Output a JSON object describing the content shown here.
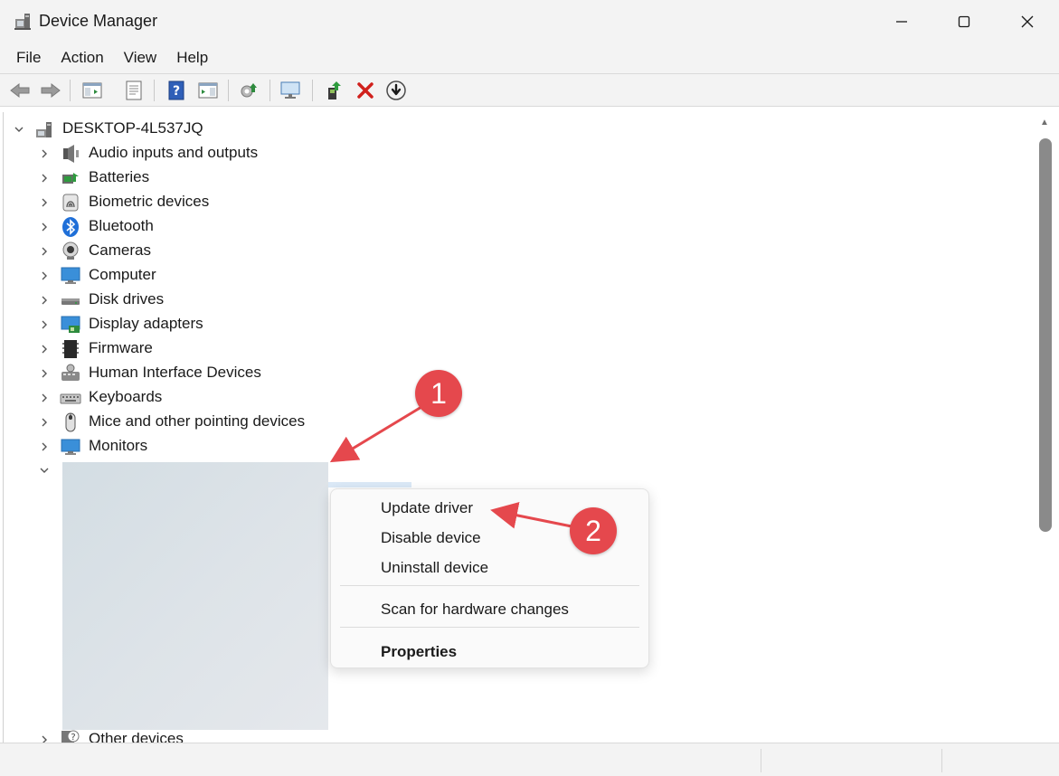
{
  "window": {
    "title": "Device Manager"
  },
  "menu": [
    "File",
    "Action",
    "View",
    "Help"
  ],
  "tree": {
    "root": "DESKTOP-4L537JQ",
    "items": [
      {
        "label": "Audio inputs and outputs",
        "icon": "speaker-icon"
      },
      {
        "label": "Batteries",
        "icon": "battery-icon"
      },
      {
        "label": "Biometric devices",
        "icon": "fingerprint-icon"
      },
      {
        "label": "Bluetooth",
        "icon": "bluetooth-icon"
      },
      {
        "label": "Cameras",
        "icon": "camera-icon"
      },
      {
        "label": "Computer",
        "icon": "computer-icon"
      },
      {
        "label": "Disk drives",
        "icon": "disk-drive-icon"
      },
      {
        "label": "Display adapters",
        "icon": "display-adapter-icon"
      },
      {
        "label": "Firmware",
        "icon": "firmware-icon"
      },
      {
        "label": "Human Interface Devices",
        "icon": "hid-icon"
      },
      {
        "label": "Keyboards",
        "icon": "keyboard-icon"
      },
      {
        "label": "Mice and other pointing devices",
        "icon": "mouse-icon"
      },
      {
        "label": "Monitors",
        "icon": "monitor-icon"
      }
    ],
    "partial_item": "Other devices"
  },
  "context_menu": {
    "update": "Update driver",
    "disable": "Disable device",
    "uninstall": "Uninstall device",
    "scan": "Scan for hardware changes",
    "properties": "Properties"
  },
  "annotations": [
    "1",
    "2"
  ],
  "colors": {
    "badge": "#e5484d",
    "accent": "#0067c0",
    "selection": "#dbe9f7"
  }
}
